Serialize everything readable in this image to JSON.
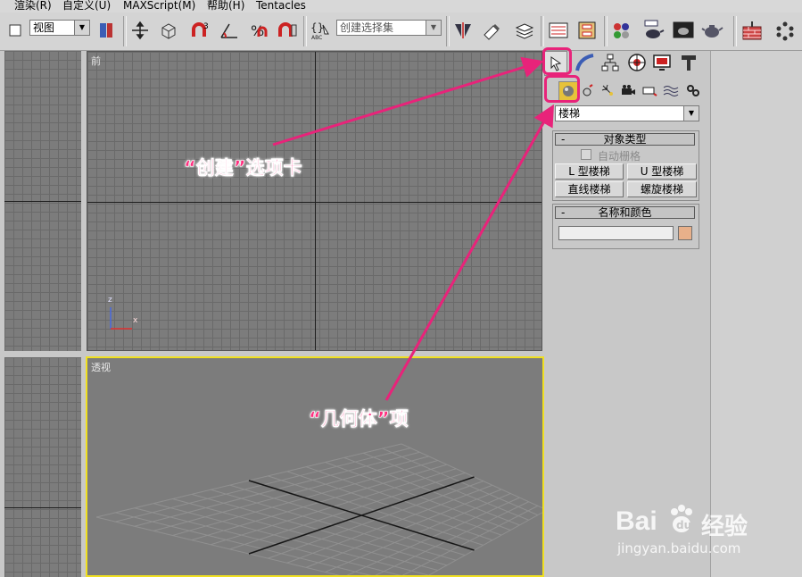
{
  "menu": [
    "渲染(R)",
    "自定义(U)",
    "MAXScript(M)",
    "帮助(H)",
    "Tentacles"
  ],
  "toolbar": {
    "viewport_select": "视图",
    "selection_set_placeholder": "创建选择集"
  },
  "viewports": {
    "front_label": "前",
    "perspective_label": "透视",
    "axis_z": "z",
    "axis_x": "x"
  },
  "command_panel": {
    "category_select": "楼梯",
    "object_type": {
      "title": "对象类型",
      "collapse": "-",
      "autogrid_label": "自动栅格",
      "autogrid_checked": false,
      "buttons": [
        "L 型楼梯",
        "U 型楼梯",
        "直线楼梯",
        "螺旋楼梯"
      ]
    },
    "name_color": {
      "title": "名称和颜色",
      "collapse": "-",
      "name_value": "",
      "swatch_color": "#e8b08a"
    }
  },
  "annotations": {
    "create_tab": "“创建”选项卡",
    "geometry": "“几何体”项"
  },
  "watermark": {
    "brand": "Bai",
    "brand_cn": "经验",
    "url": "jingyan.baidu.com"
  },
  "colors": {
    "highlight": "#e8237a",
    "active_viewport": "#f0e020"
  }
}
